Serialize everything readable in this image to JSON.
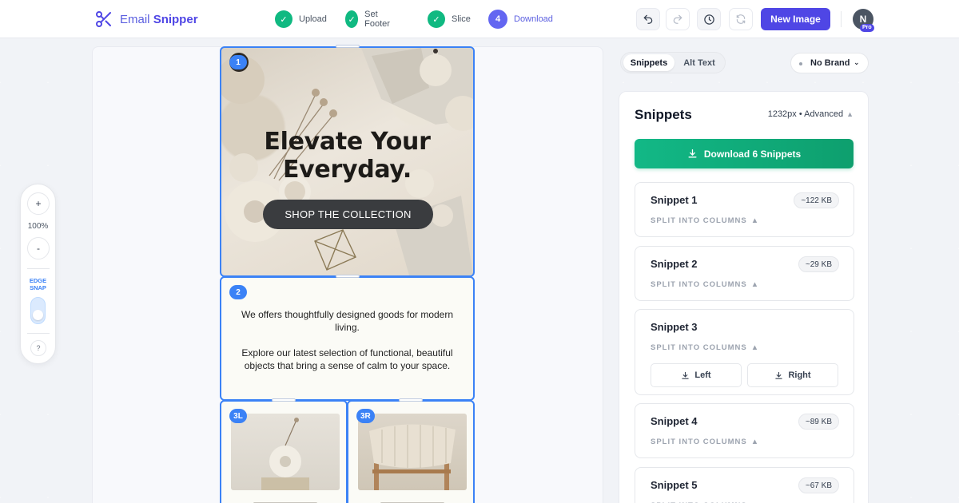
{
  "app": {
    "name_prefix": "Email ",
    "name_bold": "Snipper"
  },
  "steps": [
    {
      "label": "Upload",
      "state": "done"
    },
    {
      "label": "Set Footer",
      "state": "done"
    },
    {
      "label": "Slice",
      "state": "done"
    },
    {
      "label": "Download",
      "state": "active",
      "number": "4"
    }
  ],
  "toolbar": {
    "undo_icon": "undo-icon",
    "redo_icon": "redo-icon",
    "history_icon": "history-icon",
    "refresh_icon": "refresh-icon",
    "new_image_label": "New Image",
    "avatar_initial": "N",
    "pro_badge": "Pro"
  },
  "zoom": {
    "plus": "+",
    "level": "100%",
    "minus": "-",
    "edge_snap_line1": "EDGE",
    "edge_snap_line2": "SNAP",
    "edge_snap_on": true,
    "help": "?"
  },
  "canvas": {
    "hero": {
      "badge": "1",
      "title_line1": "Elevate Your",
      "title_line2": "Everyday.",
      "cta": "SHOP THE COLLECTION"
    },
    "text_block": {
      "badge": "2",
      "para1": "We offers thoughtfully designed goods for modern living.",
      "para2": "Explore our latest selection of functional, beautiful objects that bring a sense of calm to your space."
    },
    "columns": {
      "left_badge": "3L",
      "right_badge": "3R"
    }
  },
  "panel_tabs": {
    "active": "Snippets",
    "inactive": "Alt Text"
  },
  "brand_select": {
    "value": "No Brand"
  },
  "panel": {
    "title": "Snippets",
    "meta": "1232px • Advanced",
    "meta_icon": "▲",
    "download_label": "Download 6 Snippets",
    "split_label": "SPLIT INTO COLUMNS",
    "split_icon": "▲",
    "left_label": "Left",
    "right_label": "Right",
    "snippets": [
      {
        "title": "Snippet 1",
        "size": "~122 KB"
      },
      {
        "title": "Snippet 2",
        "size": "~29 KB"
      },
      {
        "title": "Snippet 3",
        "size": ""
      },
      {
        "title": "Snippet 4",
        "size": "~89 KB"
      },
      {
        "title": "Snippet 5",
        "size": "~67 KB"
      }
    ]
  },
  "colors": {
    "accent": "#4f46e5",
    "success": "#10b981",
    "slice_border": "#3b82f6"
  }
}
